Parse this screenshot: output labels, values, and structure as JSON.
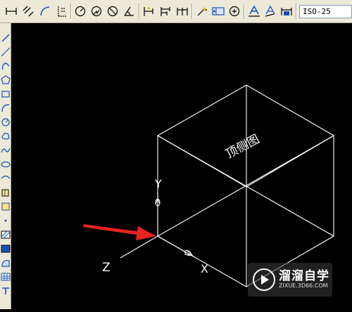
{
  "toolbar": {
    "dim_style_value": "ISO-25"
  },
  "canvas": {
    "face_label": "顶侧图",
    "ucs_x_label": "X",
    "ucs_y_label": "Y",
    "ucs_z_label": "Z",
    "background_color": "#000000",
    "line_color": "#ffffff",
    "arrow_color": "#e8231f"
  },
  "watermark": {
    "title": "溜溜自学",
    "url": "ZIXUE.3D66.COM"
  }
}
